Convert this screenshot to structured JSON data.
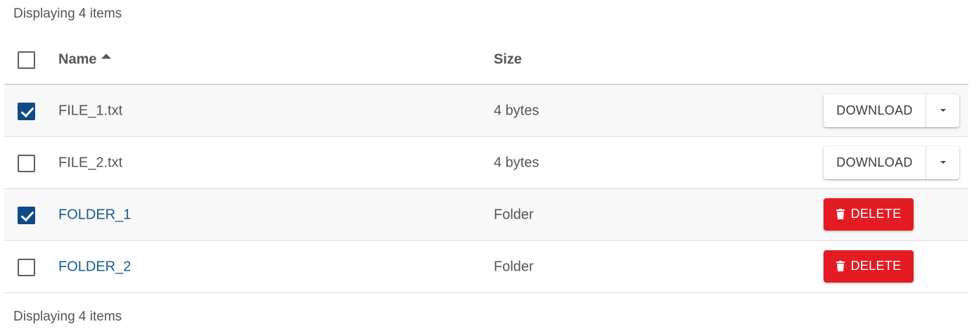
{
  "summary": {
    "count_text": "Displaying 4 items"
  },
  "table": {
    "headers": {
      "name": "Name",
      "size": "Size"
    },
    "rows": [
      {
        "name": "FILE_1.txt",
        "size": "4 bytes",
        "type": "file",
        "checked": true,
        "action_label": "DOWNLOAD"
      },
      {
        "name": "FILE_2.txt",
        "size": "4 bytes",
        "type": "file",
        "checked": false,
        "action_label": "DOWNLOAD"
      },
      {
        "name": "FOLDER_1",
        "size": "Folder",
        "type": "folder",
        "checked": true,
        "action_label": "DELETE"
      },
      {
        "name": "FOLDER_2",
        "size": "Folder",
        "type": "folder",
        "checked": false,
        "action_label": "DELETE"
      }
    ]
  },
  "icons": {
    "sort": "sort-ascending-icon",
    "dropdown": "caret-down-icon",
    "delete": "trash-icon"
  },
  "colors": {
    "checkbox_checked": "#0f4b87",
    "folder_link": "#175a8d",
    "delete_button": "#e31c23"
  }
}
